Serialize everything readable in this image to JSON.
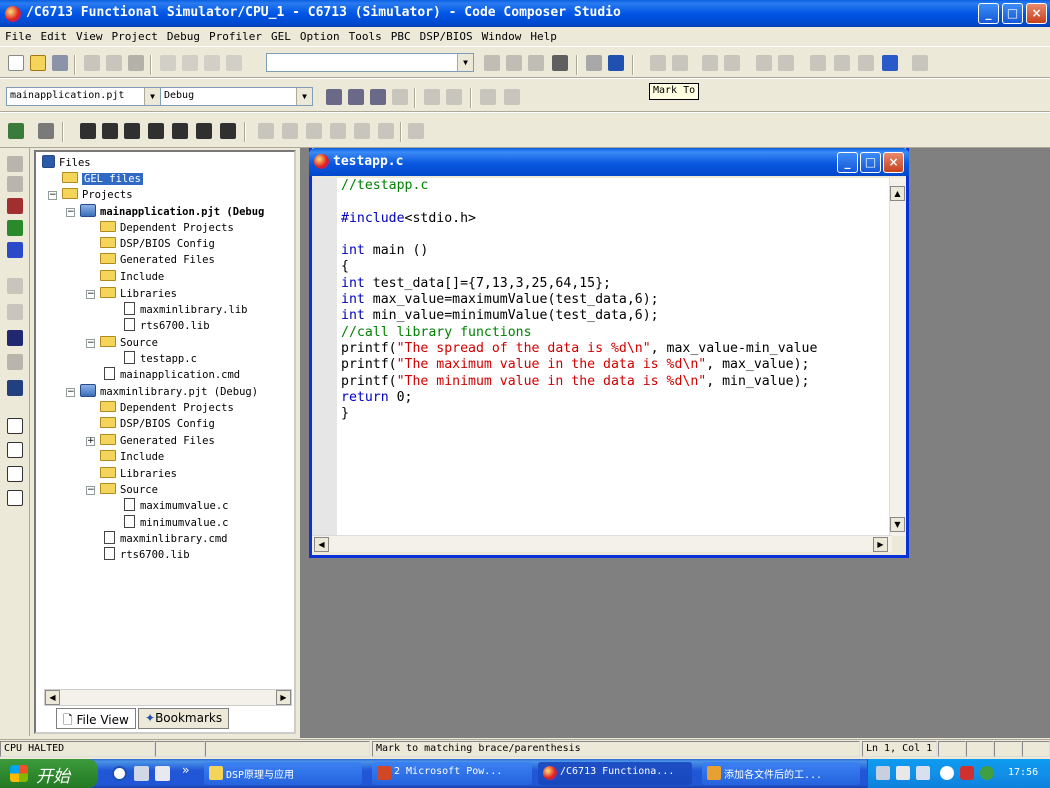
{
  "window": {
    "title": "/C6713 Functional Simulator/CPU_1 - C6713 (Simulator) - Code Composer Studio",
    "minimize": "_",
    "maximize": "□",
    "close": "×"
  },
  "menu": [
    "File",
    "Edit",
    "View",
    "Project",
    "Debug",
    "Profiler",
    "GEL",
    "Option",
    "Tools",
    "PBC",
    "DSP/BIOS",
    "Window",
    "Help"
  ],
  "toolbar": {
    "search_value": "",
    "project_select": "mainapplication.pjt",
    "config_select": "Debug",
    "tooltip": "Mark To"
  },
  "tree": {
    "root": "Files",
    "gel": "GEL files",
    "projects": "Projects",
    "p1": {
      "name": "mainapplication.pjt (Debug",
      "dependent": "Dependent Projects",
      "bios": "DSP/BIOS Config",
      "generated": "Generated Files",
      "include": "Include",
      "libraries": "Libraries",
      "lib1": "maxminlibrary.lib",
      "lib2": "rts6700.lib",
      "source": "Source",
      "src1": "testapp.c",
      "cmd": "mainapplication.cmd"
    },
    "p2": {
      "name": "maxminlibrary.pjt (Debug)",
      "dependent": "Dependent Projects",
      "bios": "DSP/BIOS Config",
      "generated": "Generated Files",
      "include": "Include",
      "libraries": "Libraries",
      "source": "Source",
      "src1": "maximumvalue.c",
      "src2": "minimumvalue.c",
      "cmd": "maxminlibrary.cmd",
      "lib": "rts6700.lib"
    },
    "tab_files": "File View",
    "tab_bookmarks": "Bookmarks"
  },
  "editor": {
    "title": "testapp.c",
    "lines": [
      [
        {
          "t": "cm",
          "v": "//testapp.c"
        }
      ],
      [
        {
          "t": "",
          "v": ""
        }
      ],
      [
        {
          "t": "pp",
          "v": "#include"
        },
        {
          "t": "",
          "v": "<stdio.h>"
        }
      ],
      [
        {
          "t": "",
          "v": ""
        }
      ],
      [
        {
          "t": "kw",
          "v": "int"
        },
        {
          "t": "",
          "v": " main ()"
        }
      ],
      [
        {
          "t": "",
          "v": "{"
        }
      ],
      [
        {
          "t": "kw",
          "v": "int"
        },
        {
          "t": "",
          "v": " test_data[]={7,13,3,25,64,15};"
        }
      ],
      [
        {
          "t": "kw",
          "v": "int"
        },
        {
          "t": "",
          "v": " max_value=maximumValue(test_data,6);"
        }
      ],
      [
        {
          "t": "kw",
          "v": "int"
        },
        {
          "t": "",
          "v": " min_value=minimumValue(test_data,6);"
        }
      ],
      [
        {
          "t": "cm",
          "v": "//call library functions"
        }
      ],
      [
        {
          "t": "",
          "v": "printf("
        },
        {
          "t": "st",
          "v": "\"The spread of the data is %d\\n\""
        },
        {
          "t": "",
          "v": ", max_value-min_value"
        }
      ],
      [
        {
          "t": "",
          "v": "printf("
        },
        {
          "t": "st",
          "v": "\"The maximum value in the data is %d\\n\""
        },
        {
          "t": "",
          "v": ", max_value);"
        }
      ],
      [
        {
          "t": "",
          "v": "printf("
        },
        {
          "t": "st",
          "v": "\"The minimum value in the data is %d\\n\""
        },
        {
          "t": "",
          "v": ", min_value);"
        }
      ],
      [
        {
          "t": "kw",
          "v": "return"
        },
        {
          "t": "",
          "v": " 0;"
        }
      ],
      [
        {
          "t": "",
          "v": "}"
        }
      ]
    ]
  },
  "status": {
    "state": "CPU HALTED",
    "message": "Mark to matching brace/parenthesis",
    "position": "Ln 1, Col 1"
  },
  "taskbar": {
    "start": "开始",
    "chevron": "»",
    "items": [
      "DSP原理与应用",
      "2 Microsoft Pow...",
      "/C6713 Functiona...",
      "添加各文件后的工..."
    ],
    "clock": "17:56"
  },
  "colors": {
    "titlebar": "#0055E5",
    "comment": "#008000",
    "keyword": "#0000C0",
    "string": "#D00000"
  }
}
